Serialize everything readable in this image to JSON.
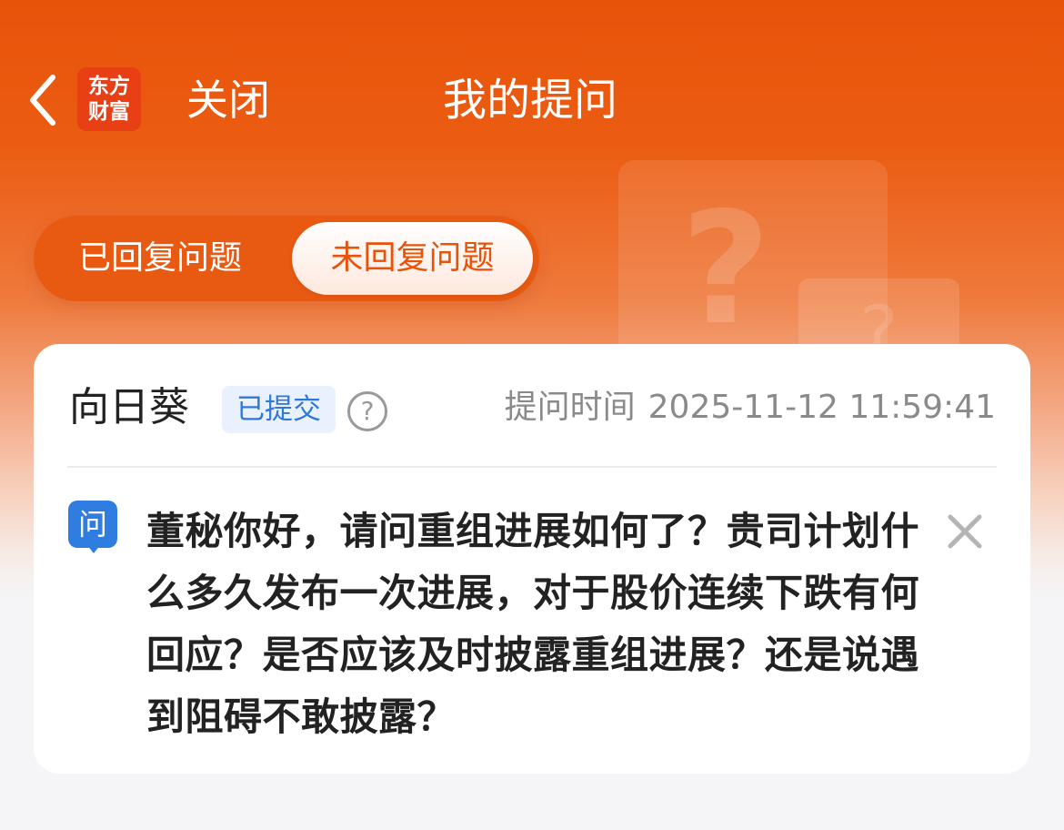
{
  "header": {
    "title": "我的提问",
    "close_label": "关闭",
    "logo_line1": "东方",
    "logo_line2": "财富"
  },
  "tabs": [
    {
      "label": "已回复问题",
      "active": false
    },
    {
      "label": "未回复问题",
      "active": true
    }
  ],
  "question_card": {
    "username": "向日葵",
    "status": "已提交",
    "time_label": "提问时间",
    "time_value": "2025-11-12 11:59:41",
    "question_icon_label": "问",
    "question_text": "董秘你好，请问重组进展如何了？贵司计划什么多久发布一次进展，对于股价连续下跌有何回应？是否应该及时披露重组进展？还是说遇到阻碍不敢披露？"
  },
  "colors": {
    "brand_orange": "#e8530a",
    "badge_blue": "#2f78d8",
    "question_icon_blue": "#2f7de0"
  },
  "icons": [
    "back-chevron-icon",
    "help-circle-icon",
    "close-icon",
    "question-mark-decoration-icon"
  ]
}
